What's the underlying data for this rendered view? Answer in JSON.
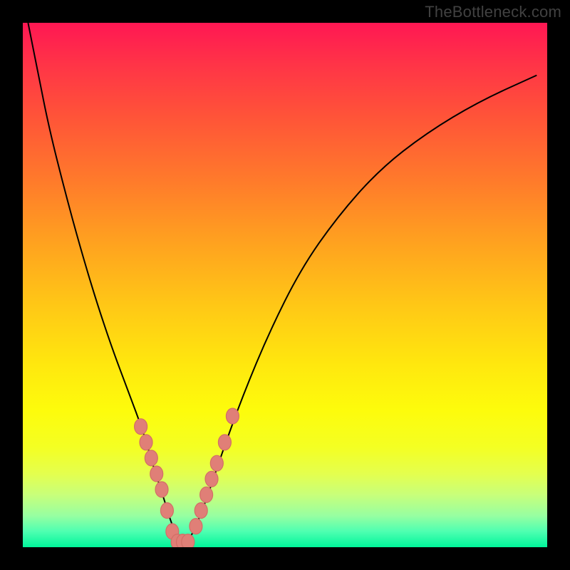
{
  "watermark": "TheBottleneck.com",
  "chart_data": {
    "type": "line",
    "title": "",
    "xlabel": "",
    "ylabel": "",
    "xlim": [
      0,
      100
    ],
    "ylim": [
      0,
      100
    ],
    "grid": false,
    "legend": false,
    "series": [
      {
        "name": "bottleneck-curve",
        "x": [
          1,
          3,
          5,
          8,
          11,
          14,
          17,
          20,
          23,
          25,
          27,
          28.5,
          30,
          31.5,
          33,
          35,
          38,
          42,
          47,
          53,
          60,
          68,
          77,
          87,
          98
        ],
        "y": [
          100,
          90,
          80,
          68,
          57,
          47,
          38,
          30,
          22,
          15,
          9,
          4,
          1,
          1,
          4,
          9,
          18,
          29,
          41,
          53,
          63,
          72,
          79,
          85,
          90
        ]
      }
    ],
    "markers": {
      "name": "highlight-points",
      "x": [
        22.5,
        23.5,
        24.5,
        25.5,
        26.5,
        27.5,
        28.5,
        29.5,
        30.5,
        31.5,
        33.0,
        34.0,
        35.0,
        36.0,
        37.0,
        38.5,
        40.0
      ],
      "y": [
        23,
        20,
        17,
        14,
        11,
        7,
        3,
        1,
        1,
        1,
        4,
        7,
        10,
        13,
        16,
        20,
        25
      ]
    },
    "colors": {
      "gradient_top": "#ff1753",
      "gradient_bottom": "#00f59a",
      "curve": "#000000",
      "marker_fill": "#e07f77",
      "background": "#000000"
    }
  }
}
